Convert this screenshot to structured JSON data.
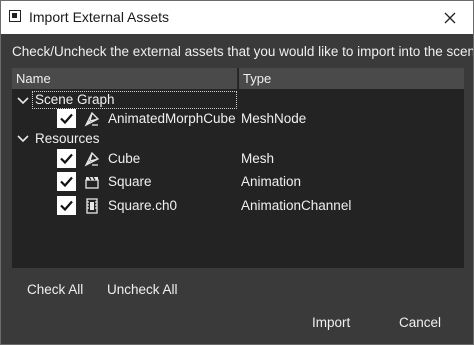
{
  "window": {
    "title": "Import External Assets",
    "close_icon": "close-icon"
  },
  "instruction": "Check/Uncheck the external assets that you would like to import into the scene.",
  "tree": {
    "columns": [
      "Name",
      "Type"
    ],
    "groups": [
      {
        "label": "Scene Graph",
        "expanded": true,
        "items": [
          {
            "name": "AnimatedMorphCube",
            "type": "MeshNode",
            "checked": true,
            "icon": "mesh-icon"
          }
        ]
      },
      {
        "label": "Resources",
        "expanded": true,
        "items": [
          {
            "name": "Cube",
            "type": "Mesh",
            "checked": true,
            "icon": "mesh-icon"
          },
          {
            "name": "Square",
            "type": "Animation",
            "checked": true,
            "icon": "clapperboard-icon"
          },
          {
            "name": "Square.ch0",
            "type": "AnimationChannel",
            "checked": true,
            "icon": "film-strip-icon"
          }
        ]
      }
    ]
  },
  "buttons": {
    "check_all": "Check All",
    "uncheck_all": "Uncheck All",
    "import": "Import",
    "cancel": "Cancel"
  },
  "colors": {
    "dialog_bg": "#3a3a3a",
    "tree_bg": "#232323",
    "header_bg": "#4a4a4a",
    "text": "#f0f0f0"
  }
}
